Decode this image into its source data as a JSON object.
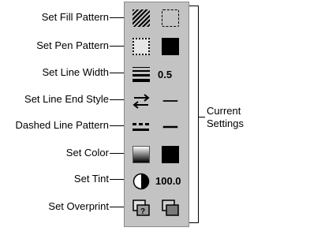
{
  "labels": {
    "fill_pattern": "Set Fill Pattern",
    "pen_pattern": "Set Pen Pattern",
    "line_width": "Set Line Width",
    "line_end_style": "Set Line End Style",
    "dashed_line_pattern": "Dashed Line Pattern",
    "color": "Set Color",
    "tint": "Set Tint",
    "overprint": "Set Overprint"
  },
  "values": {
    "line_width": "0.5",
    "tint": "100.0"
  },
  "current_settings": {
    "line1": "Current",
    "line2": "Settings"
  },
  "colors": {
    "panel": "#c3c3c3",
    "current_fill": "#000000",
    "current_pen": "#000000"
  },
  "icons": {
    "fill_pattern": "hatch-icon",
    "pen_pattern": "dotted-square-icon",
    "line_width": "line-width-icon",
    "line_end_style": "arrows-icon",
    "dashed_line_pattern": "dashed-line-icon",
    "color": "gradient-icon",
    "tint": "half-circle-icon",
    "overprint": "overprint-icon"
  }
}
